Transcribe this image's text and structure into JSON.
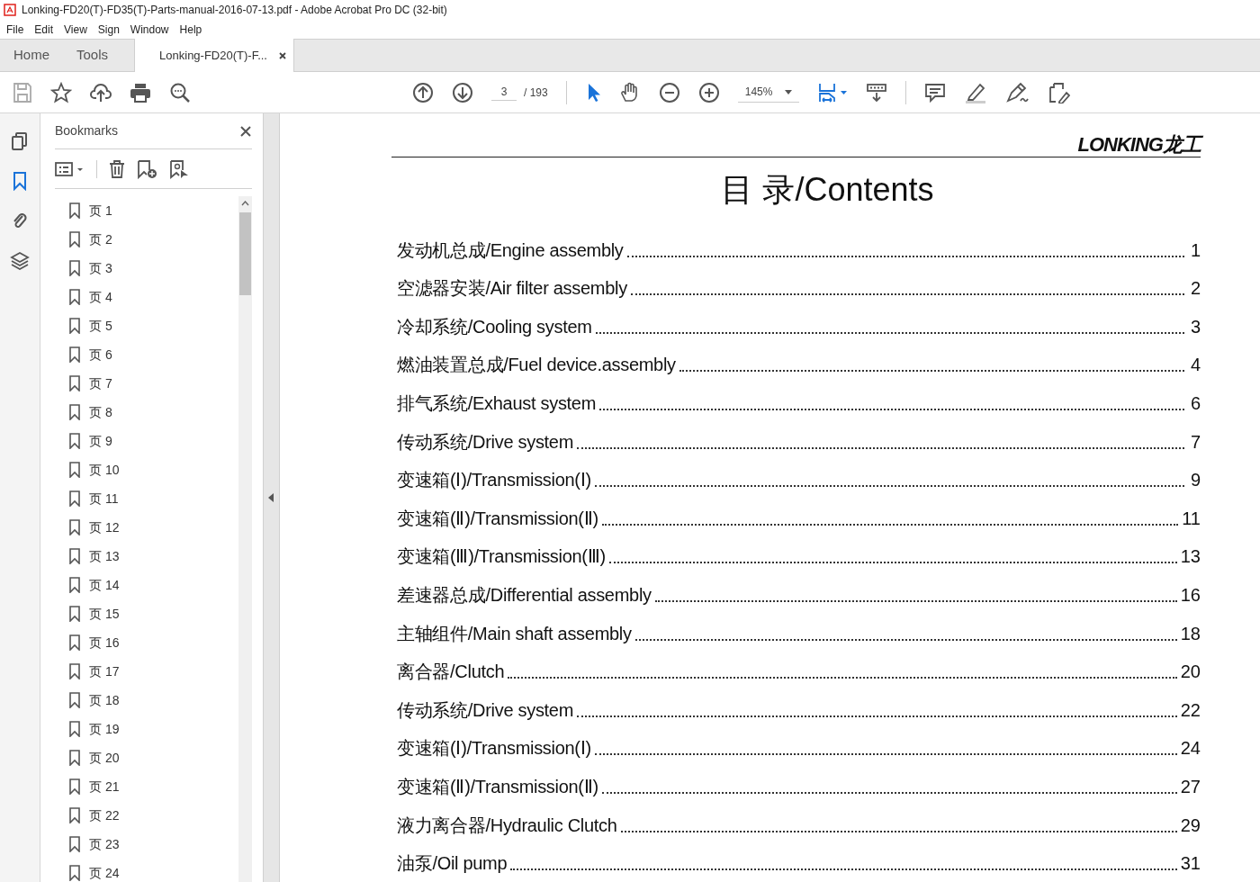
{
  "window": {
    "title": "Lonking-FD20(T)-FD35(T)-Parts-manual-2016-07-13.pdf - Adobe Acrobat Pro DC (32-bit)"
  },
  "menu": [
    "File",
    "Edit",
    "View",
    "Sign",
    "Window",
    "Help"
  ],
  "tabs": [
    {
      "label": "Home",
      "selected": false
    },
    {
      "label": "Tools",
      "selected": false
    },
    {
      "label": "Lonking-FD20(T)-F...",
      "selected": true
    }
  ],
  "toolbar": {
    "page": "3",
    "page_total": "/ 193",
    "zoom": "145%"
  },
  "bookmarks": {
    "title": "Bookmarks",
    "items": [
      "页 1",
      "页 2",
      "页 3",
      "页 4",
      "页 5",
      "页 6",
      "页 7",
      "页 8",
      "页 9",
      "页 10",
      "页 11",
      "页 12",
      "页 13",
      "页 14",
      "页 15",
      "页 16",
      "页 17",
      "页 18",
      "页 19",
      "页 20",
      "页 21",
      "页 22",
      "页 23",
      "页 24"
    ]
  },
  "document": {
    "logo": "LONKING龙工",
    "heading": "目 录/Contents",
    "entries": [
      {
        "label": "发动机总成/Engine assembly",
        "page": "1"
      },
      {
        "label": "空滤器安装/Air filter assembly",
        "page": "2"
      },
      {
        "label": "冷却系统/Cooling system",
        "page": "3"
      },
      {
        "label": "燃油装置总成/Fuel device.assembly",
        "page": "4"
      },
      {
        "label": "排气系统/Exhaust system",
        "page": "6"
      },
      {
        "label": "传动系统/Drive system",
        "page": "7"
      },
      {
        "label": "变速箱(Ⅰ)/Transmission(Ⅰ)",
        "page": "9"
      },
      {
        "label": "变速箱(Ⅱ)/Transmission(Ⅱ)",
        "page": "11"
      },
      {
        "label": "变速箱(Ⅲ)/Transmission(Ⅲ)",
        "page": "13"
      },
      {
        "label": "差速器总成/Differential assembly",
        "page": "16"
      },
      {
        "label": "主轴组件/Main shaft assembly",
        "page": "18"
      },
      {
        "label": "离合器/Clutch",
        "page": "20"
      },
      {
        "label": "传动系统/Drive system",
        "page": "22"
      },
      {
        "label": "变速箱(Ⅰ)/Transmission(Ⅰ)",
        "page": "24"
      },
      {
        "label": "变速箱(Ⅱ)/Transmission(Ⅱ)",
        "page": "27"
      },
      {
        "label": "液力离合器/Hydraulic Clutch",
        "page": "29"
      },
      {
        "label": "油泵/Oil pump",
        "page": "31"
      }
    ]
  }
}
